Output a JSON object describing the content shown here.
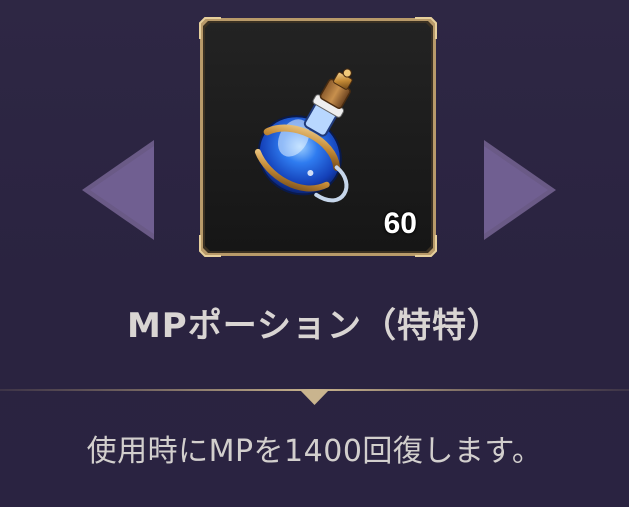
{
  "item": {
    "name": "MPポーション（特特）",
    "quantity": "60",
    "description": "使用時にMPを1400回復します。",
    "icon": "mp-potion-icon"
  },
  "navigation": {
    "prev_icon": "chevron-left-icon",
    "next_icon": "chevron-right-icon"
  },
  "colors": {
    "background": "#2b2440",
    "arrow": "#6a5a86",
    "frame_gold": "#b89a6a",
    "text": "#d9d5d3",
    "divider_gold": "#a89270"
  }
}
